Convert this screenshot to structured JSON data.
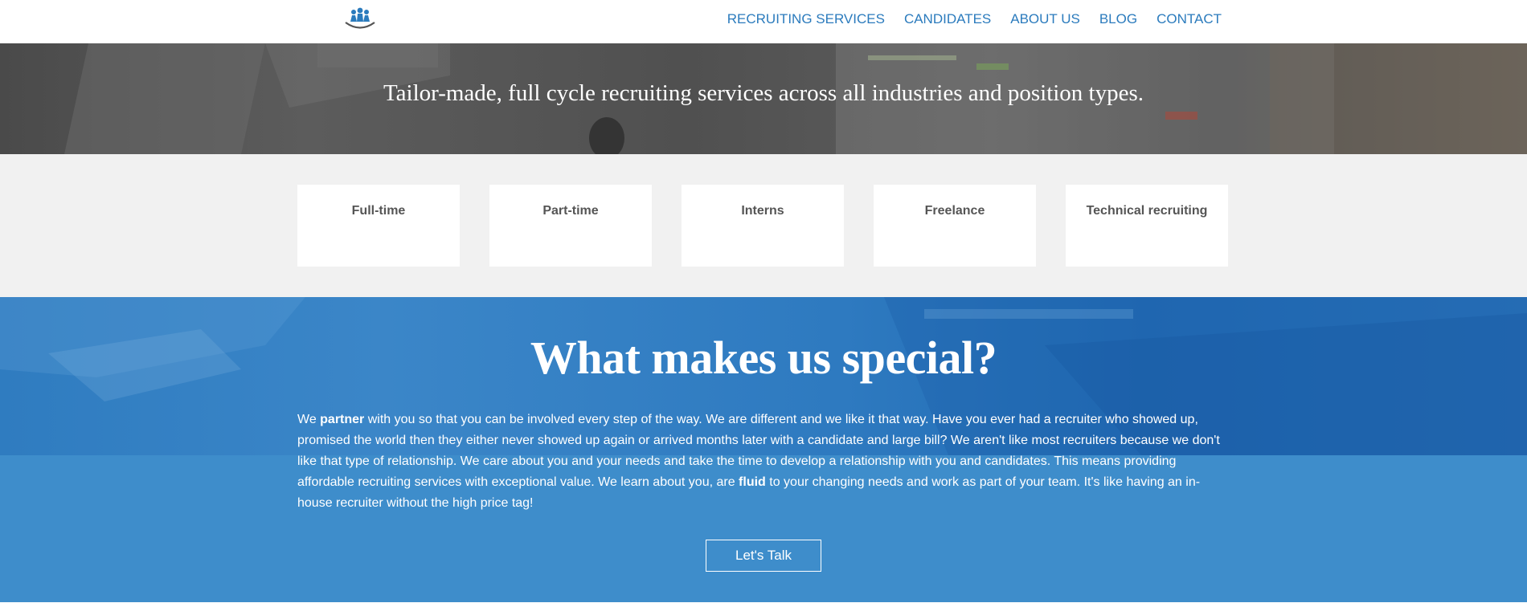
{
  "brand": {
    "logo_icon": "people-group-logo-icon",
    "accent": "#2b7bbd"
  },
  "nav": {
    "items": [
      {
        "label": "RECRUITING SERVICES"
      },
      {
        "label": "CANDIDATES"
      },
      {
        "label": "ABOUT US"
      },
      {
        "label": "BLOG"
      },
      {
        "label": "CONTACT"
      }
    ]
  },
  "hero": {
    "tagline": "Tailor-made, full cycle recruiting services across all industries and position types."
  },
  "services": {
    "cards": [
      {
        "label": "Full-time"
      },
      {
        "label": "Part-time"
      },
      {
        "label": "Interns"
      },
      {
        "label": "Freelance"
      },
      {
        "label": "Technical recruiting"
      }
    ]
  },
  "special": {
    "title": "What makes us special?",
    "p1": "We ",
    "b1": "partner",
    "p2": " with you so that you can be involved every step of the way. We are different and we like it that way. Have you ever had a recruiter who showed up, promised the world then they either never showed up again or arrived months later with a candidate and large bill? We aren't like most recruiters because we don't like that type of relationship. We care about you and your needs and take the time to develop a relationship with you and candidates. This means providing affordable recruiting services with exceptional value. We learn about you, are ",
    "b2": "fluid",
    "p3": " to your changing needs and work as part of your team. It's like having an in-house recruiter without the high price tag!",
    "button_label": "Let's Talk",
    "bg_color": "#3e8dcb"
  }
}
